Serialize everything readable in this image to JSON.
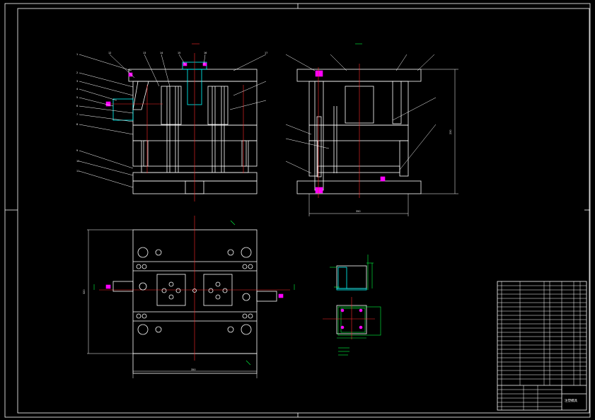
{
  "sheet": {
    "background": "#000000",
    "line_color": "#ffffff",
    "center_line_color": "#ff2a2a",
    "dimension_color": "#00ff40",
    "accent_magenta": "#ff00ff",
    "accent_cyan": "#00ffff"
  },
  "front_view": {
    "part_numbers_left": [
      "1",
      "2",
      "3",
      "4",
      "5",
      "6",
      "7",
      "8",
      "9",
      "10",
      "11"
    ],
    "part_numbers_top": [
      "12",
      "13",
      "14",
      "15",
      "16",
      "17"
    ]
  },
  "side_view": {
    "dim_height": "230",
    "dim_width": "350"
  },
  "plan_view": {
    "dim_width": "350",
    "dim_height": "320"
  },
  "title_block": {
    "title": "注塑模具"
  }
}
